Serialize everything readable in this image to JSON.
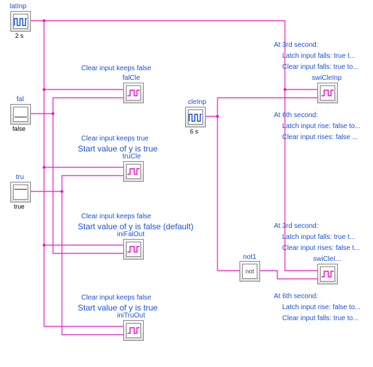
{
  "blocks": {
    "latInp": {
      "name": "latInp",
      "caption": "2 s"
    },
    "fal": {
      "name": "fal",
      "caption": "false"
    },
    "tru": {
      "name": "tru",
      "caption": "true"
    },
    "cleInp": {
      "name": "cleInp",
      "caption": "6 s"
    },
    "falCle": {
      "name": "falCle"
    },
    "truCle": {
      "name": "truCle"
    },
    "iniFalOut": {
      "name": "iniFalOut"
    },
    "iniTruOut": {
      "name": "iniTruOut"
    },
    "swiCleInp": {
      "name": "swiCleInp"
    },
    "swiCleI": {
      "name": "swiCleI..."
    },
    "not1": {
      "name": "not1",
      "text": "not"
    }
  },
  "annotations": {
    "clearFalse1": "Clear input keeps false",
    "clearTrue": "Clear input keeps true",
    "startTrue1": "Start value of y is true",
    "clearFalse2": "Clear input keeps false",
    "startFalseDef": "Start value of y is false (default)",
    "clearFalse3": "Clear input keeps false",
    "startTrue2": "Start value of y is true",
    "at3a_head": "At 3rd second:",
    "at3a_l1": "Latch input falls: true t...",
    "at3a_l2": "Clear input falls: true to...",
    "at6a_head": "At 6th second:",
    "at6a_l1": "Latch input rise: false to...",
    "at6a_l2": "Clear input rises: false ...",
    "at3b_head": "At 3rd second:",
    "at3b_l1": "Latch input falls: true t...",
    "at3b_l2": "Clear input rises: false t...",
    "at6b_head": "At 6th second:",
    "at6b_l1": "Latch input rise: false to...",
    "at6b_l2": "Clear input falls: true to..."
  }
}
